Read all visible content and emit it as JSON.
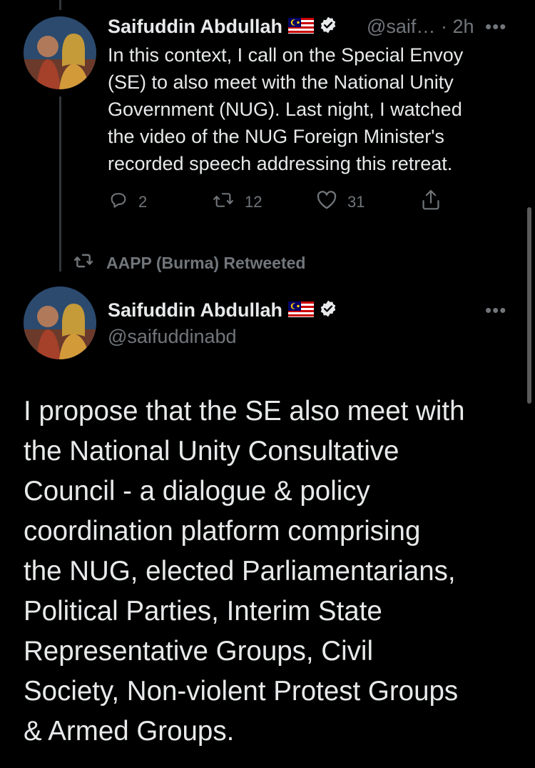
{
  "tweet1": {
    "author": "Saifuddin Abdullah",
    "flag": "malaysia-flag",
    "handle": "@saif…",
    "time": "· 2h",
    "more": "•••",
    "text_lines": [
      "In this context, I call on the Special Envoy",
      "(SE) to also meet with the National Unity",
      "Government (NUG). Last night, I watched",
      "the video of the NUG Foreign Minister's",
      "recorded speech addressing this retreat."
    ],
    "actions": {
      "replies": "2",
      "retweets": "12",
      "likes": "31"
    }
  },
  "retweet_label": "AAPP (Burma) Retweeted",
  "tweet2": {
    "author": "Saifuddin Abdullah",
    "flag": "malaysia-flag",
    "handle": "@saifuddinabd",
    "more": "•••",
    "text_lines": [
      "I propose that the SE also meet with",
      "the National Unity Consultative",
      "Council - a dialogue & policy",
      "coordination platform comprising",
      "the NUG, elected Parliamentarians,",
      "Political Parties, Interim State",
      "Representative Groups, Civil",
      "Society, Non-violent Protest Groups",
      "& Armed Groups."
    ]
  },
  "colors": {
    "background": "#000000",
    "text": "#e7e9ea",
    "muted": "#71767b"
  }
}
